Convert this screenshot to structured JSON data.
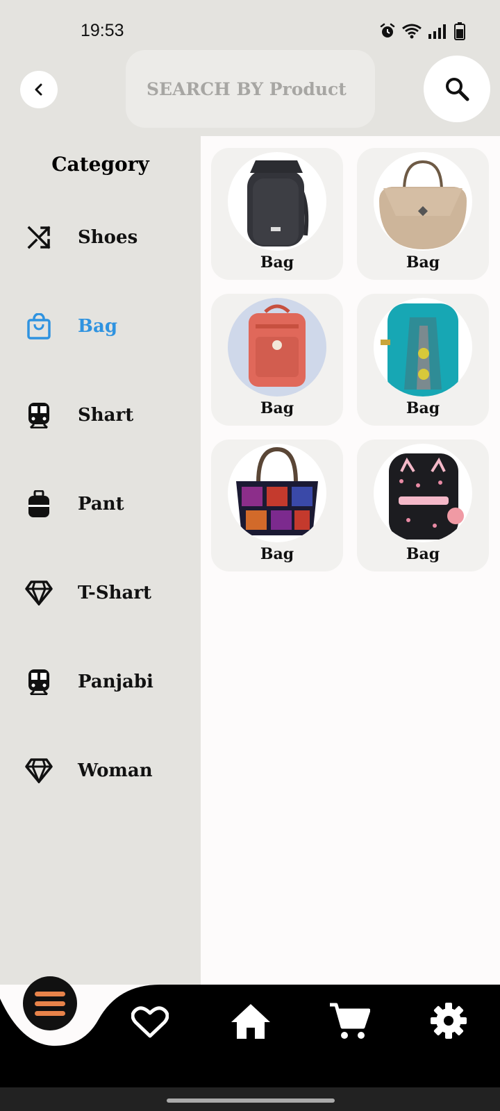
{
  "status_bar": {
    "time": "19:53"
  },
  "search": {
    "placeholder": "SEARCH BY Product"
  },
  "sidebar": {
    "title": "Category",
    "items": [
      {
        "label": "Shoes",
        "icon": "shuffle-icon",
        "active": false
      },
      {
        "label": "Bag",
        "icon": "shopping-bag-icon",
        "active": true
      },
      {
        "label": "Shart",
        "icon": "train-icon",
        "active": false
      },
      {
        "label": "Pant",
        "icon": "luggage-icon",
        "active": false
      },
      {
        "label": "T-Shart",
        "icon": "diamond-icon",
        "active": false
      },
      {
        "label": "Panjabi",
        "icon": "train-icon",
        "active": false
      },
      {
        "label": "Woman",
        "icon": "diamond-icon",
        "active": false
      }
    ]
  },
  "products": [
    {
      "name": "Bag",
      "image": "black-backpack"
    },
    {
      "name": "Bag",
      "image": "beige-handbag"
    },
    {
      "name": "Bag",
      "image": "coral-backpack"
    },
    {
      "name": "Bag",
      "image": "teal-backpack"
    },
    {
      "name": "Bag",
      "image": "embroidered-tote"
    },
    {
      "name": "Bag",
      "image": "black-kids-backpack"
    }
  ],
  "bottom_nav": {
    "items": [
      "menu-icon",
      "heart-icon",
      "home-icon",
      "cart-icon",
      "gear-icon"
    ]
  },
  "colors": {
    "accent": "#2f93e0",
    "menu_accent": "#e8834a",
    "sidebar_bg": "#e4e3df",
    "nav_bg": "#000000"
  }
}
